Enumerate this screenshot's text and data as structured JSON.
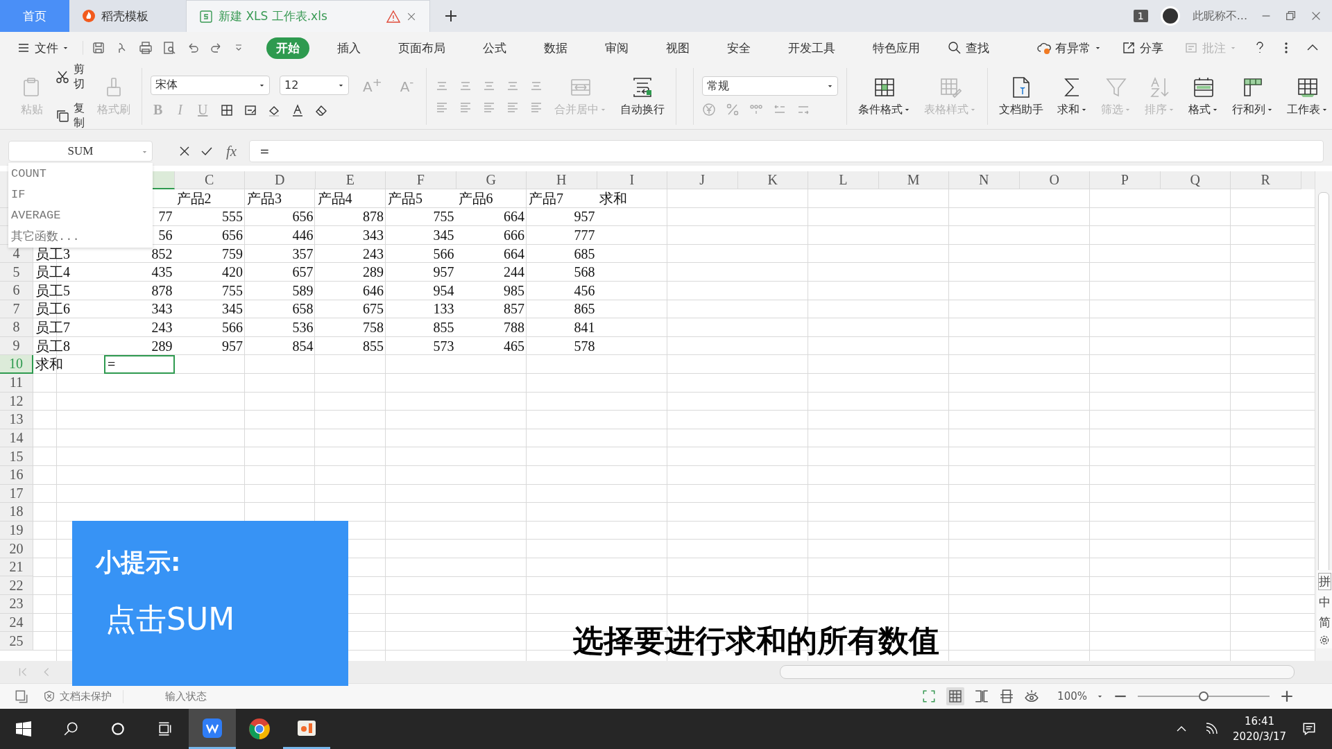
{
  "doc_tabs": [
    {
      "label": "首页",
      "kind": "home",
      "selected": false,
      "warning": false
    },
    {
      "label": "稻壳模板",
      "kind": "docer",
      "selected": false,
      "warning": false
    },
    {
      "label": "新建 XLS 工作表.xls",
      "kind": "sheet",
      "selected": true,
      "warning": true
    }
  ],
  "window": {
    "badge": "1",
    "user": "此昵称不..."
  },
  "menu": {
    "file": "文件",
    "tabs": [
      {
        "label": "开始",
        "selected": true
      },
      {
        "label": "插入",
        "selected": false
      },
      {
        "label": "页面布局",
        "selected": false
      },
      {
        "label": "公式",
        "selected": false
      },
      {
        "label": "数据",
        "selected": false
      },
      {
        "label": "审阅",
        "selected": false
      },
      {
        "label": "视图",
        "selected": false
      },
      {
        "label": "安全",
        "selected": false
      },
      {
        "label": "开发工具",
        "selected": false
      },
      {
        "label": "特色应用",
        "selected": false
      }
    ],
    "search": "查找",
    "actions": [
      {
        "label": "有异常",
        "kind": "cloud",
        "disabled": false
      },
      {
        "label": "分享",
        "kind": "share",
        "disabled": false
      },
      {
        "label": "批注",
        "kind": "comment",
        "disabled": true
      }
    ]
  },
  "ribbon": {
    "clipboard": [
      {
        "label": "粘贴",
        "kind": "paste",
        "disabled": true
      },
      {
        "label": "剪切",
        "kind": "cut",
        "disabled": false
      },
      {
        "label": "复制",
        "kind": "copy",
        "disabled": false
      },
      {
        "label": "格式刷",
        "kind": "brush",
        "disabled": true
      }
    ],
    "font_name": "宋体",
    "font_size": "12",
    "font_grow": "A$^{+}$",
    "font_shrink": "A$^{-}$",
    "style_buttons": [
      "B",
      "I",
      "U"
    ],
    "align_buttons": [
      {
        "label": "合并居中",
        "kind": "merge",
        "disabled": true
      },
      {
        "label": "自动换行",
        "kind": "wrap",
        "disabled": false
      }
    ],
    "number_format": "常规",
    "tools": [
      {
        "label": "条件格式",
        "kind": "conditional",
        "disabled": false,
        "dropdown": true
      },
      {
        "label": "表格样式",
        "kind": "table-style",
        "disabled": true,
        "dropdown": true
      },
      {
        "label": "文档助手",
        "kind": "assistant",
        "disabled": false,
        "dropdown": false
      },
      {
        "label": "求和",
        "kind": "sum",
        "disabled": false,
        "dropdown": true
      },
      {
        "label": "筛选",
        "kind": "filter",
        "disabled": true,
        "dropdown": true
      },
      {
        "label": "排序",
        "kind": "sort",
        "disabled": true,
        "dropdown": true
      },
      {
        "label": "格式",
        "kind": "format",
        "disabled": false,
        "dropdown": true
      },
      {
        "label": "行和列",
        "kind": "rows-cols",
        "disabled": false,
        "dropdown": true
      },
      {
        "label": "工作表",
        "kind": "worksheet",
        "disabled": false,
        "dropdown": true
      }
    ]
  },
  "formula_bar": {
    "name_box": "SUM",
    "fx": "fx",
    "formula": "=",
    "functions": [
      "COUNT",
      "IF",
      "AVERAGE",
      "其它函数..."
    ]
  },
  "sheet": {
    "columns": [
      {
        "selected": true
      },
      {
        "letter": "C",
        "selected": false
      },
      {
        "letter": "D",
        "selected": false
      },
      {
        "letter": "E",
        "selected": false
      },
      {
        "letter": "F",
        "selected": false
      },
      {
        "letter": "G",
        "selected": false
      },
      {
        "letter": "H",
        "selected": false
      },
      {
        "letter": "I",
        "selected": false
      },
      {
        "letter": "J",
        "selected": false
      },
      {
        "letter": "K",
        "selected": false
      },
      {
        "letter": "L",
        "selected": false
      },
      {
        "letter": "M",
        "selected": false
      },
      {
        "letter": "N",
        "selected": false
      },
      {
        "letter": "O",
        "selected": false
      },
      {
        "letter": "P",
        "selected": false
      },
      {
        "letter": "Q",
        "selected": false
      },
      {
        "letter": "R",
        "selected": false
      }
    ],
    "rows": [
      {
        "kind": "header",
        "selected": false,
        "cells": [
          null,
          null,
          "产品2",
          "产品3",
          "产品4",
          "产品5",
          "产品6",
          "产品7",
          "求和"
        ]
      },
      {
        "kind": "data",
        "selected": false,
        "cells": [
          null,
          "77",
          "555",
          "656",
          "878",
          "755",
          "664",
          "957"
        ]
      },
      {
        "kind": "data",
        "selected": false,
        "cells": [
          null,
          "56",
          "656",
          "446",
          "343",
          "345",
          "666",
          "777"
        ]
      },
      {
        "number": "4",
        "kind": "data",
        "selected": false,
        "cells": [
          "员工3",
          "852",
          "759",
          "357",
          "243",
          "566",
          "664",
          "685"
        ]
      },
      {
        "number": "5",
        "kind": "data",
        "selected": false,
        "cells": [
          "员工4",
          "435",
          "420",
          "657",
          "289",
          "957",
          "244",
          "568"
        ]
      },
      {
        "number": "6",
        "kind": "data",
        "selected": false,
        "cells": [
          "员工5",
          "878",
          "755",
          "589",
          "646",
          "954",
          "985",
          "456"
        ]
      },
      {
        "number": "7",
        "kind": "data",
        "selected": false,
        "cells": [
          "员工6",
          "343",
          "345",
          "658",
          "675",
          "133",
          "857",
          "865"
        ]
      },
      {
        "number": "8",
        "kind": "data",
        "selected": false,
        "cells": [
          "员工7",
          "243",
          "566",
          "536",
          "758",
          "855",
          "788",
          "841"
        ]
      },
      {
        "number": "9",
        "kind": "data",
        "selected": false,
        "cells": [
          "员工8",
          "289",
          "957",
          "854",
          "855",
          "573",
          "465",
          "578"
        ]
      },
      {
        "number": "10",
        "kind": "data",
        "selected": true,
        "cells": [
          "求和",
          "="
        ]
      },
      {
        "number": "11",
        "kind": "data",
        "selected": false
      },
      {
        "number": "12",
        "kind": "data",
        "selected": false
      },
      {
        "number": "13",
        "kind": "data",
        "selected": false
      },
      {
        "number": "14",
        "kind": "data",
        "selected": false
      },
      {
        "number": "15",
        "kind": "data",
        "selected": false
      },
      {
        "number": "16",
        "kind": "data",
        "selected": false
      },
      {
        "number": "17",
        "kind": "data",
        "selected": false
      },
      {
        "number": "18",
        "kind": "data",
        "selected": false
      },
      {
        "number": "19",
        "kind": "data",
        "selected": false
      },
      {
        "number": "20",
        "kind": "data",
        "selected": false
      },
      {
        "number": "21",
        "kind": "data",
        "selected": false
      },
      {
        "number": "22",
        "kind": "data",
        "selected": false
      },
      {
        "number": "23",
        "kind": "data",
        "selected": false
      },
      {
        "number": "24",
        "kind": "data",
        "selected": false
      },
      {
        "number": "25",
        "kind": "data",
        "selected": false
      }
    ]
  },
  "status_bar": {
    "protection": "文档未保护",
    "input_state": "输入状态",
    "zoom": "100%",
    "zoom_slider": {
      "level": 0.5
    }
  },
  "tip": {
    "title": "小提示:",
    "text": "点击SUM"
  },
  "subtitle": "选择要进行求和的所有数值",
  "ime": [
    "拼",
    "中",
    "简"
  ],
  "taskbar": {
    "apps": [
      {
        "kind": "wps",
        "selected": true,
        "running": true
      },
      {
        "kind": "chrome",
        "selected": false,
        "running": false
      },
      {
        "kind": "recorder",
        "selected": false,
        "running": true
      }
    ],
    "time": "16:41",
    "date": "2020/3/17"
  }
}
